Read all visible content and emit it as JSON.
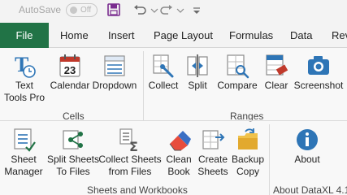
{
  "quick_access": {
    "autosave_label": "AutoSave",
    "autosave_state": "Off"
  },
  "tabs": {
    "file": "File",
    "items": [
      "Home",
      "Insert",
      "Page Layout",
      "Formulas",
      "Data",
      "Rev"
    ]
  },
  "ribbon": {
    "cells_group": {
      "label": "Cells",
      "buttons": [
        "Text\nTools Pro",
        "Calendar",
        "Dropdown"
      ]
    },
    "ranges_group": {
      "label": "Ranges",
      "buttons": [
        "Collect",
        "Split",
        "Compare",
        "Clear",
        "Screenshot"
      ]
    },
    "sheets_group": {
      "label": "Sheets and Workbooks",
      "buttons": [
        "Sheet\nManager",
        "Split Sheets\nTo Files",
        "Collect Sheets\nfrom Files",
        "Clean\nBook",
        "Create\nSheets",
        "Backup\nCopy"
      ]
    },
    "about_group": {
      "label": "About DataXL 4.1",
      "buttons": [
        "About"
      ]
    },
    "calendar_day": "23"
  },
  "colors": {
    "file_tab": "#217346",
    "save_icon": "#7a2c8f",
    "about_icon": "#2e75b6"
  }
}
